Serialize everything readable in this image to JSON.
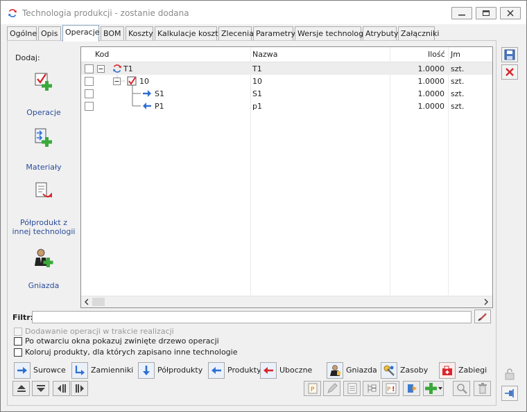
{
  "window": {
    "title": "Technologia produkcji - zostanie dodana",
    "icon": "refresh-icon"
  },
  "tabs": [
    {
      "label": "Ogólne"
    },
    {
      "label": "Opis"
    },
    {
      "label": "Operacje",
      "active": true
    },
    {
      "label": "BOM"
    },
    {
      "label": "Koszty"
    },
    {
      "label": "Kalkulacje kosztu"
    },
    {
      "label": "Zlecenia"
    },
    {
      "label": "Parametry"
    },
    {
      "label": "Wersje technologii"
    },
    {
      "label": "Atrybuty"
    },
    {
      "label": "Załączniki"
    }
  ],
  "sidebar": {
    "dodaj_label": "Dodaj:",
    "items": [
      {
        "label": "Operacje",
        "icon": "operation-add-icon"
      },
      {
        "label": "Materiały",
        "icon": "material-add-icon"
      },
      {
        "label": "Półprodukt z innej technologii",
        "icon": "semiproduct-import-icon"
      },
      {
        "label": "Gniazda",
        "icon": "workstation-add-icon"
      }
    ]
  },
  "tree": {
    "columns": {
      "kod": "Kod",
      "nazwa": "Nazwa",
      "ilosc": "Ilość",
      "jm": "Jm"
    },
    "rows": [
      {
        "kod": "T1",
        "nazwa": "T1",
        "ilosc": "1.0000",
        "jm": "szt.",
        "icon": "technology-icon"
      },
      {
        "kod": "10",
        "nazwa": "10",
        "ilosc": "1.0000",
        "jm": "szt.",
        "icon": "operation-icon"
      },
      {
        "kod": "S1",
        "nazwa": "S1",
        "ilosc": "1.0000",
        "jm": "szt.",
        "icon": "arrow-right-icon"
      },
      {
        "kod": "P1",
        "nazwa": "p1",
        "ilosc": "1.0000",
        "jm": "szt.",
        "icon": "arrow-left-icon"
      }
    ]
  },
  "filter": {
    "label": "Filtr:",
    "value": ""
  },
  "options": [
    {
      "label": "Dodawanie operacji w trakcie realizacji",
      "disabled": true,
      "checked": false
    },
    {
      "label": "Po otwarciu okna pokazuj zwinięte drzewo operacji",
      "disabled": false,
      "checked": false
    },
    {
      "label": "Koloruj produkty, dla których zapisano inne technologie",
      "disabled": false,
      "checked": false
    }
  ],
  "legend": [
    {
      "label": "Surowce",
      "icon": "arrow-right-icon"
    },
    {
      "label": "Zamienniki",
      "icon": "substitute-icon"
    },
    {
      "label": "Półprodukty",
      "icon": "arrow-down-icon"
    },
    {
      "label": "Produkty",
      "icon": "arrow-left-icon"
    },
    {
      "label": "Uboczne",
      "icon": "arrow-left-red-icon"
    },
    {
      "label": "Gniazda",
      "icon": "workstation-icon"
    },
    {
      "label": "Zasoby",
      "icon": "resource-icon"
    },
    {
      "label": "Zabiegi",
      "icon": "procedure-icon"
    }
  ],
  "colors": {
    "blue_arrow": "#2f6fd1",
    "red_mark": "#d8262c",
    "green_plus": "#3aa93a",
    "link_blue": "#2a4c9a"
  }
}
